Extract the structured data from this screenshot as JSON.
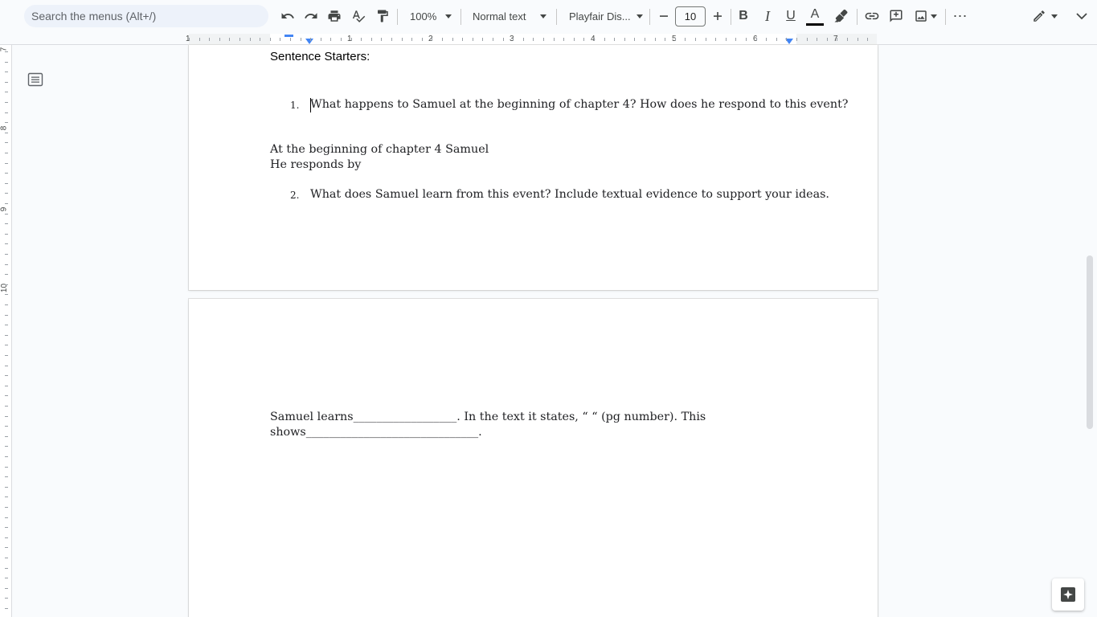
{
  "toolbar": {
    "search_placeholder": "Search the menus (Alt+/)",
    "zoom": "100%",
    "style": "Normal text",
    "font": "Playfair Dis...",
    "font_size": "10",
    "bold_label": "B",
    "italic_label": "I",
    "underline_label": "U",
    "text_color_label": "A",
    "text_color": "#000000",
    "more_label": "⋯"
  },
  "ruler": {
    "h_numbers": [
      "1",
      "1",
      "2",
      "3",
      "4",
      "5",
      "6",
      "7"
    ],
    "v_numbers": [
      "7",
      "8",
      "9",
      "10"
    ]
  },
  "document": {
    "page1": {
      "heading": "Sentence Starters:",
      "q1_num": "1.",
      "q1_text": "What happens to Samuel at the beginning of chapter 4? How does he respond to this event?",
      "starter1": "At the beginning of chapter 4 Samuel",
      "starter2": "He responds by",
      "q2_num": "2.",
      "q2_text": "What does Samuel learn from this event? Include textual evidence to support your ideas."
    },
    "page2": {
      "line1": "Samuel learns__________________. In the text it states, “              “ (pg number). This",
      "line2": "shows______________________________."
    }
  }
}
